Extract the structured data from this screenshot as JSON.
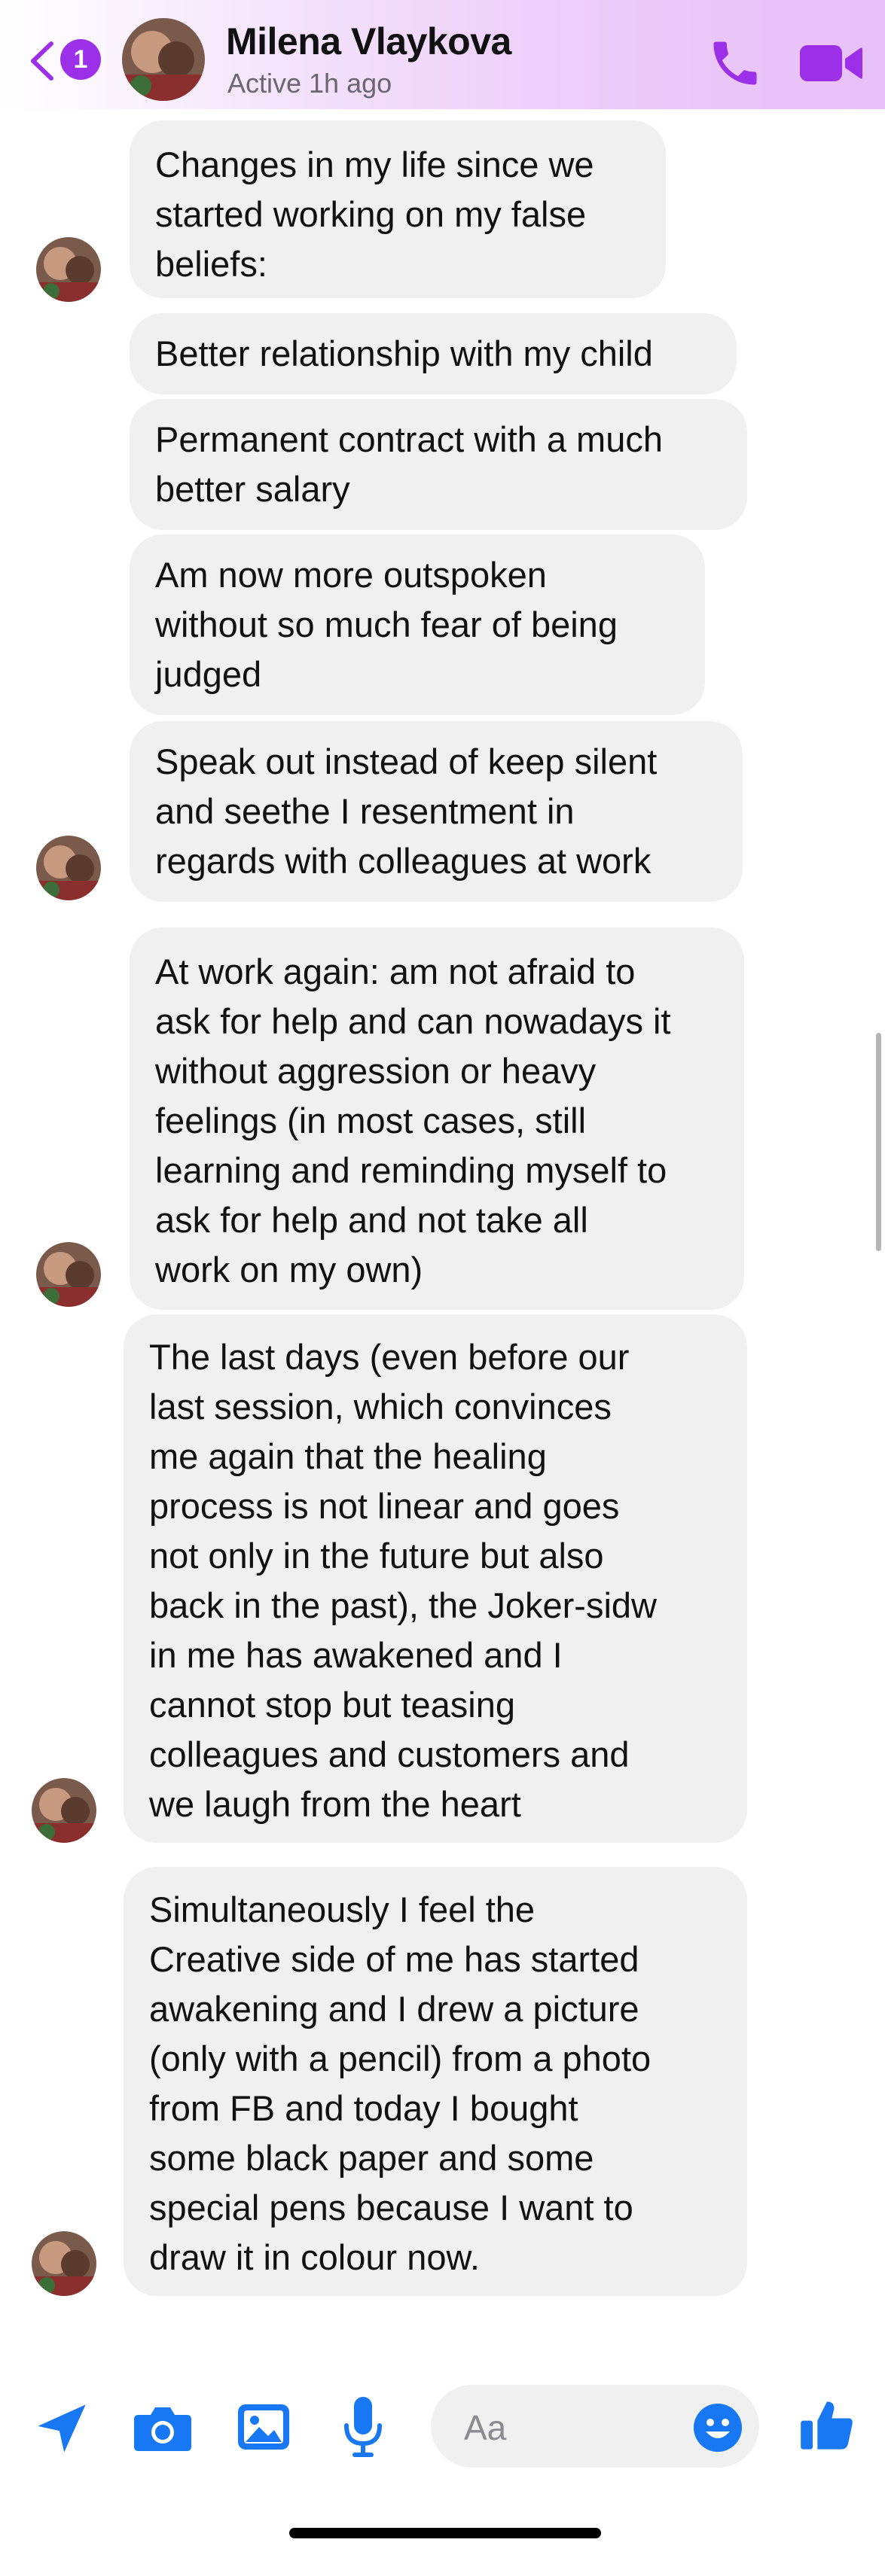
{
  "header": {
    "back_count": "1",
    "contact_name": "Milena Vlaykova",
    "status": "Active 1h ago",
    "accent_color": "#9b30e8"
  },
  "messages": [
    {
      "text": "Changes in my life since we\nstarted working on my false\nbeliefs:"
    },
    {
      "text": "Better relationship with my child"
    },
    {
      "text": "Permanent contract with a much\nbetter salary"
    },
    {
      "text": "Am now more outspoken\nwithout so much fear of being\njudged"
    },
    {
      "text": "Speak out instead of keep silent\nand seethe I resentment in\nregards with colleagues at work"
    },
    {
      "text": "At work again: am not afraid to\nask for help and can nowadays it\nwithout aggression or heavy\nfeelings (in most cases, still\nlearning and reminding myself to\nask for help and not take all\nwork on my own)"
    },
    {
      "text": "The last days (even before our\nlast session, which convinces\nme again that the healing\nprocess is not linear and goes\nnot only in the future but also\nback in the past), the Joker-sidw\nin me has awakened and I\ncannot stop but teasing\ncolleagues and customers and\nwe laugh from the heart"
    },
    {
      "text": "Simultaneously I feel the\nCreative side of me has started\nawakening and I drew a picture\n(only with a pencil) from a photo\nfrom FB and today I bought\nsome black paper and some\nspecial pens because I want to\ndraw it in colour now."
    }
  ],
  "composer": {
    "placeholder": "Aa",
    "icon_color": "#1877f2",
    "icons": [
      "send-icon",
      "camera-icon",
      "gallery-icon",
      "microphone-icon",
      "emoji-icon",
      "thumbs-up-icon"
    ]
  }
}
